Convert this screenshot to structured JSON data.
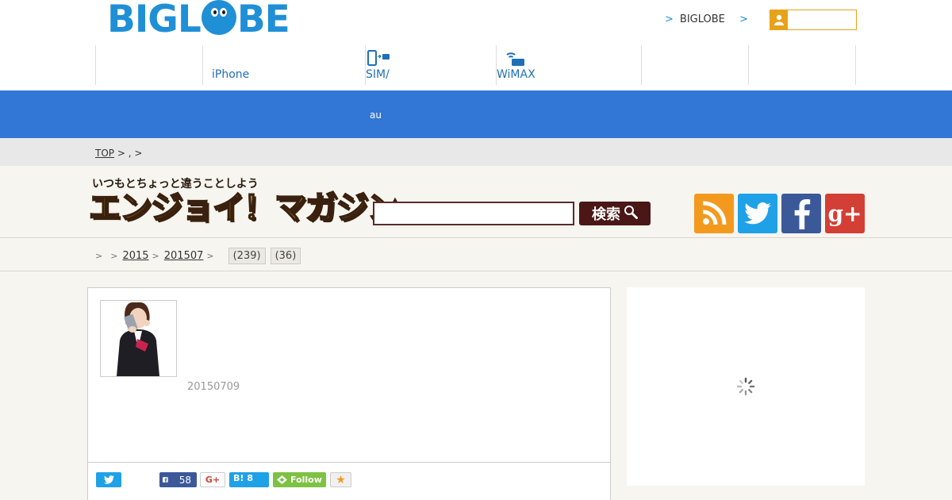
{
  "header": {
    "logo": {
      "prefix": "BIGL",
      "suffix": "BE"
    },
    "top_links": [
      {
        "label": "BIGLOBE"
      },
      {
        "label": ""
      }
    ],
    "login_placeholder": "",
    "nav": [
      {
        "label": "",
        "icon": ""
      },
      {
        "label": "iPhone",
        "icon": ""
      },
      {
        "label": "SIM/",
        "icon": "sim-phone-icon"
      },
      {
        "label": "WiMAX",
        "icon": "wimax-router-icon"
      },
      {
        "label": "",
        "icon": ""
      },
      {
        "label": "",
        "icon": ""
      }
    ]
  },
  "band": {
    "label": "au"
  },
  "breadcrumb": {
    "top": "TOP",
    "sep1": ">",
    "mid": ",",
    "sep2": ">"
  },
  "magazine": {
    "subtitle": "いつもとちょっと違うことしよう",
    "title": "エンジョイ！マガジン",
    "search_placeholder": "",
    "search_button": "検索",
    "social": [
      "rss-icon",
      "twitter-icon",
      "facebook-icon",
      "google-plus-icon"
    ],
    "gplus_glyph": "g+"
  },
  "categories": {
    "year": "2015",
    "month": "201507",
    "tags": [
      "(239)",
      "(36)"
    ]
  },
  "article": {
    "date": "20150709",
    "share": {
      "facebook_count": "58",
      "hatena_label": "B!",
      "hatena_count": "8",
      "gplus_label": "G+",
      "follow_label": "Follow",
      "star": "★"
    }
  },
  "colors": {
    "brand_blue": "#1f8fd6",
    "band_blue": "#3276d6",
    "search_button": "#4a1616",
    "title_yellow": "#ffe22e"
  }
}
